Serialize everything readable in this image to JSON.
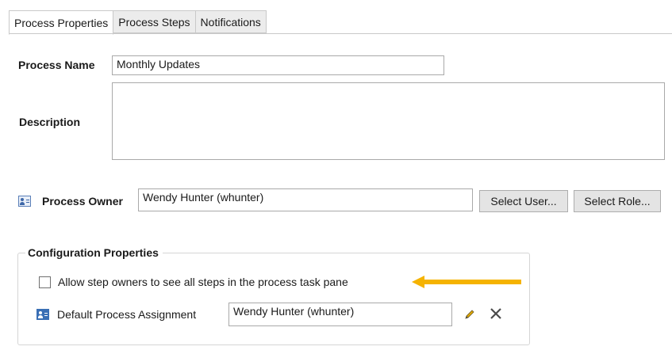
{
  "tabs": [
    {
      "label": "Process Properties",
      "active": true
    },
    {
      "label": "Process Steps",
      "active": false
    },
    {
      "label": "Notifications",
      "active": false
    }
  ],
  "form": {
    "process_name_label": "Process Name",
    "process_name_value": "Monthly Updates",
    "description_label": "Description",
    "description_value": "",
    "process_owner_label": "Process Owner",
    "process_owner_value": "Wendy Hunter (whunter)",
    "select_user_label": "Select User...",
    "select_role_label": "Select Role..."
  },
  "config": {
    "title": "Configuration Properties",
    "allow_steps_label": "Allow step owners to see all steps in the process task pane",
    "allow_steps_checked": false,
    "default_assignment_label": "Default Process Assignment",
    "default_assignment_value": "Wendy Hunter (whunter)"
  },
  "icons": {
    "owner": "user-card-icon",
    "assignment": "user-card-icon",
    "edit": "pencil-icon",
    "clear": "close-icon",
    "annotation": "arrow-left-icon"
  },
  "colors": {
    "arrow": "#f5b301",
    "icon_blue": "#3a6fb5"
  }
}
